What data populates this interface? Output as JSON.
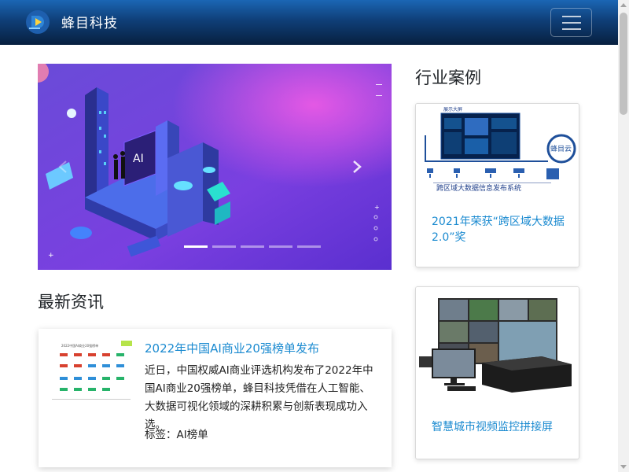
{
  "header": {
    "brand_name": "蜂目科技"
  },
  "carousel": {
    "slide_count": 5,
    "active_slide": 1
  },
  "sections": {
    "cases_title": "行业案例",
    "news_title": "最新资讯"
  },
  "news": [
    {
      "title": "2022年中国AI商业20强榜单发布",
      "body": "近日，中国权威AI商业评选机构发布了2022年中国AI商业20强榜单，蜂目科技凭借在人工智能、大数据可视化领域的深耕积累与创新表现成功入选。",
      "tags": "标签：AI榜单",
      "thumb_label": "2022中国AI商业20强榜单"
    }
  ],
  "cases": [
    {
      "caption": "2021年荣获“跨区域大数据2.0”奖",
      "img_text": {
        "screen_title": "展示大屏",
        "brand": "蜂目云",
        "system": "跨区域大数据信息发布系统"
      }
    },
    {
      "caption": "智慧城市视频监控拼接屏",
      "img_text": {}
    }
  ]
}
